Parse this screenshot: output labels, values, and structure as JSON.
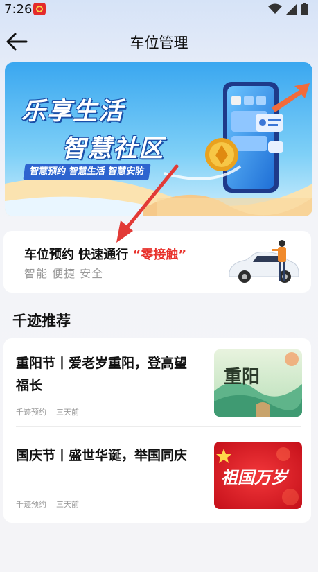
{
  "status_bar": {
    "time": "7:26"
  },
  "header": {
    "title": "车位管理"
  },
  "banner": {
    "title_line1": "乐享生活",
    "title_line2": "智慧社区",
    "tags": "智慧预约 智慧生活 智慧安防"
  },
  "promo": {
    "headline": "车位预约 快速通行",
    "highlight": "“零接触”",
    "subtitle": "智能 便捷 安全"
  },
  "recommend": {
    "section_title": "千迹推荐",
    "articles": [
      {
        "title": "重阳节丨爱老岁重阳，登高望福长",
        "source": "千迹预约",
        "time": "三天前",
        "thumb_text": "重阳"
      },
      {
        "title": "国庆节丨盛世华诞，举国同庆",
        "source": "千迹预约",
        "time": "三天前",
        "thumb_text": "祖国万岁"
      }
    ]
  },
  "colors": {
    "accent_red": "#e8322c",
    "banner_blue": "#2d64cf",
    "background": "#f4f4f7"
  }
}
